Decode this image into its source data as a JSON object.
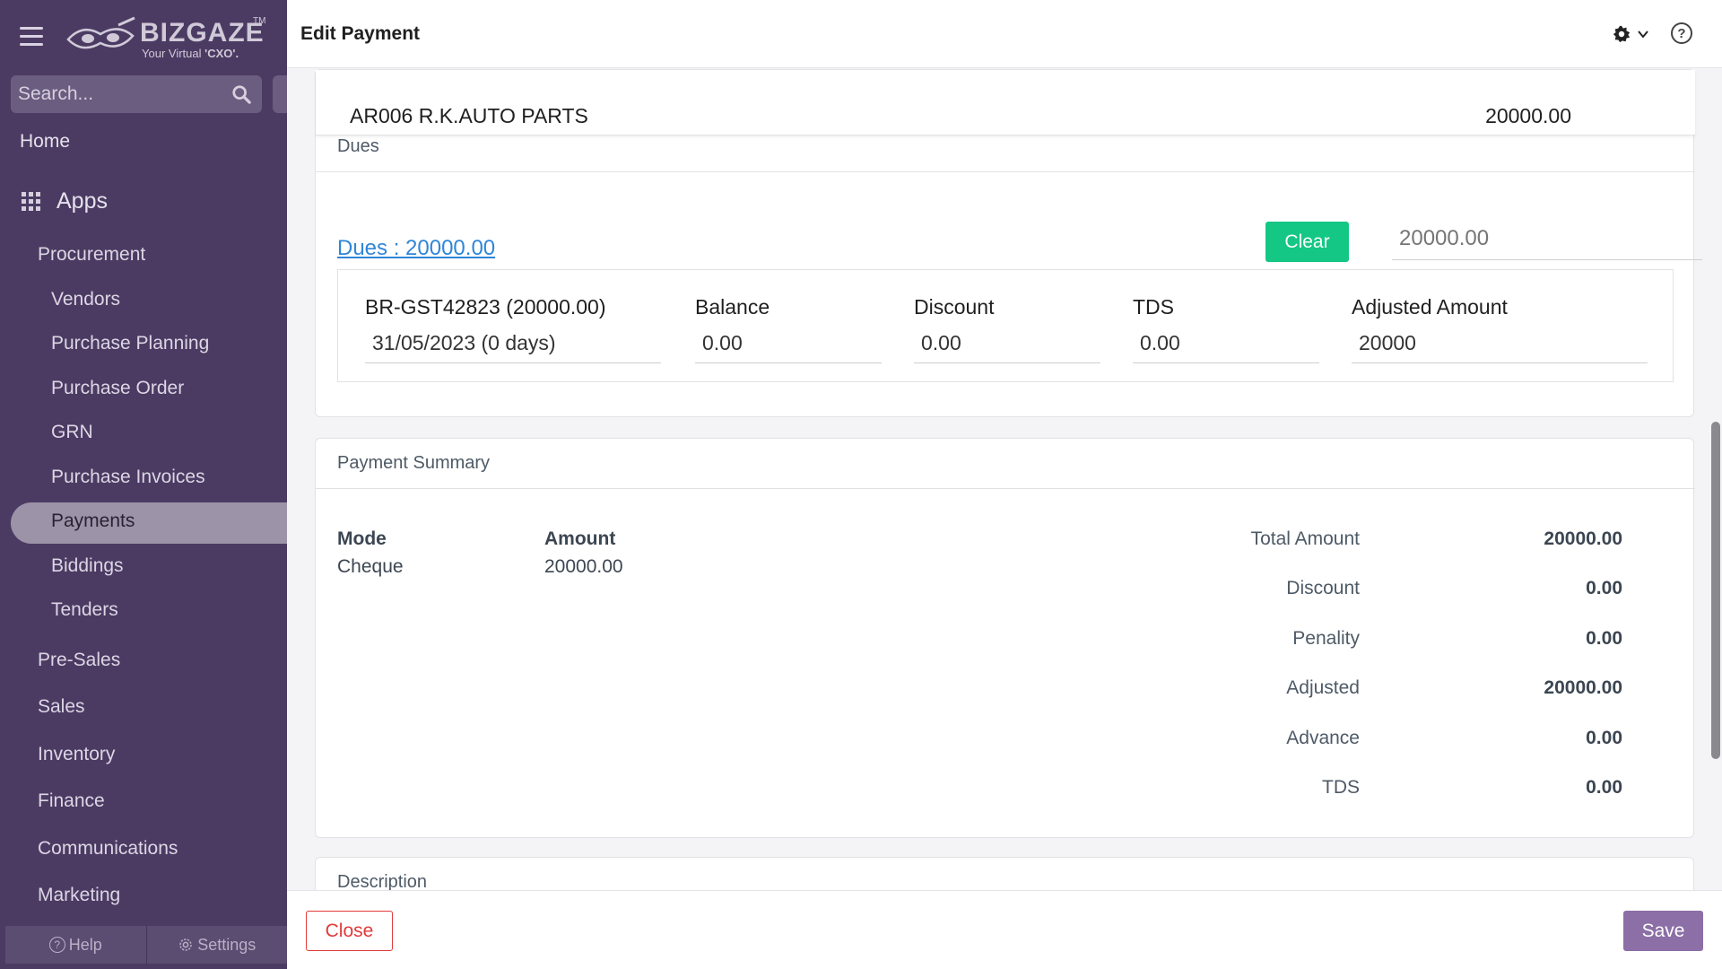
{
  "sidebar": {
    "logo": {
      "name": "BIZGAZE",
      "trademark": "TM",
      "tagline_prefix": "Your Virtual ",
      "tagline_bold": "'CXO'."
    },
    "search_placeholder": "Search...",
    "home": "Home",
    "apps": "Apps",
    "groups_top": [
      {
        "label": "Procurement"
      }
    ],
    "procurement_items": [
      {
        "label": "Vendors"
      },
      {
        "label": "Purchase Planning"
      },
      {
        "label": "Purchase Order"
      },
      {
        "label": "GRN"
      },
      {
        "label": "Purchase Invoices"
      },
      {
        "label": "Payments",
        "active": true
      },
      {
        "label": "Biddings"
      },
      {
        "label": "Tenders"
      }
    ],
    "groups_bottom": [
      {
        "label": "Pre-Sales"
      },
      {
        "label": "Sales"
      },
      {
        "label": "Inventory"
      },
      {
        "label": "Finance"
      },
      {
        "label": "Communications"
      },
      {
        "label": "Marketing"
      }
    ],
    "footer": {
      "help": "Help",
      "settings": "Settings"
    }
  },
  "header": {
    "title": "Edit Payment"
  },
  "customer": {
    "name": "AR006 R.K.AUTO PARTS",
    "amount": "20000.00"
  },
  "dues": {
    "section_label": "Dues",
    "link_text": "Dues : 20000.00",
    "clear_label": "Clear",
    "amount_placeholder": "20000.00",
    "invoice": {
      "number": "BR-GST42823 (20000.00)",
      "date": "31/05/2023 (0 days)",
      "balance_label": "Balance",
      "balance": "0.00",
      "discount_label": "Discount",
      "discount": "0.00",
      "tds_label": "TDS",
      "tds": "0.00",
      "adjusted_label": "Adjusted Amount",
      "adjusted": "20000"
    }
  },
  "payment_summary": {
    "section_label": "Payment Summary",
    "mode_header": "Mode",
    "amount_header": "Amount",
    "mode": "Cheque",
    "amount": "20000.00",
    "totals": {
      "total_label": "Total Amount",
      "total": "20000.00",
      "discount_label": "Discount",
      "discount": "0.00",
      "penality_label": "Penality",
      "penality": "0.00",
      "adjusted_label": "Adjusted",
      "adjusted": "20000.00",
      "advance_label": "Advance",
      "advance": "0.00",
      "tds_label": "TDS",
      "tds": "0.00"
    }
  },
  "description": {
    "section_label": "Description"
  },
  "footer": {
    "close_label": "Close",
    "save_label": "Save"
  },
  "colors": {
    "sidebar_bg": "#4b3b63",
    "clear_button": "#14c784",
    "save_button": "#8c6fa6",
    "close_button": "#e23a3a",
    "link": "#2f86d8"
  }
}
